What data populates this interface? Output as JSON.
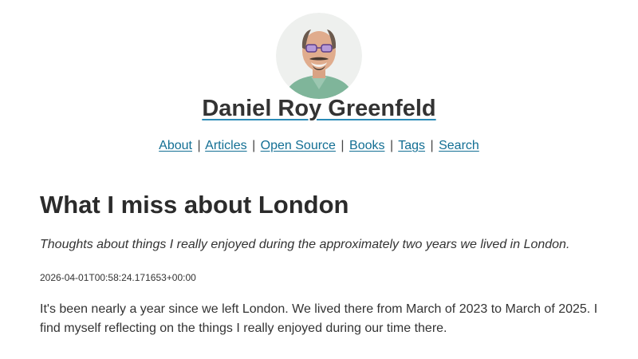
{
  "site": {
    "title": "Daniel Roy Greenfeld",
    "avatar_icon": "author-photo"
  },
  "nav": {
    "items": [
      {
        "label": "About"
      },
      {
        "label": "Articles"
      },
      {
        "label": "Open Source"
      },
      {
        "label": "Books"
      },
      {
        "label": "Tags"
      },
      {
        "label": "Search"
      }
    ],
    "separator": "|"
  },
  "post": {
    "title": "What I miss about London",
    "subtitle": "Thoughts about things I really enjoyed during the approximately two years we lived in London.",
    "timestamp": "2026-04-01T00:58:24.171653+00:00",
    "body": "It's been nearly a year since we left London. We lived there from March of 2023 to March of 2025. I find myself reflecting on the things I really enjoyed during our time there."
  },
  "colors": {
    "link": "#136f94",
    "title_underline": "#2b8bb8",
    "text": "#2b2b2b"
  }
}
